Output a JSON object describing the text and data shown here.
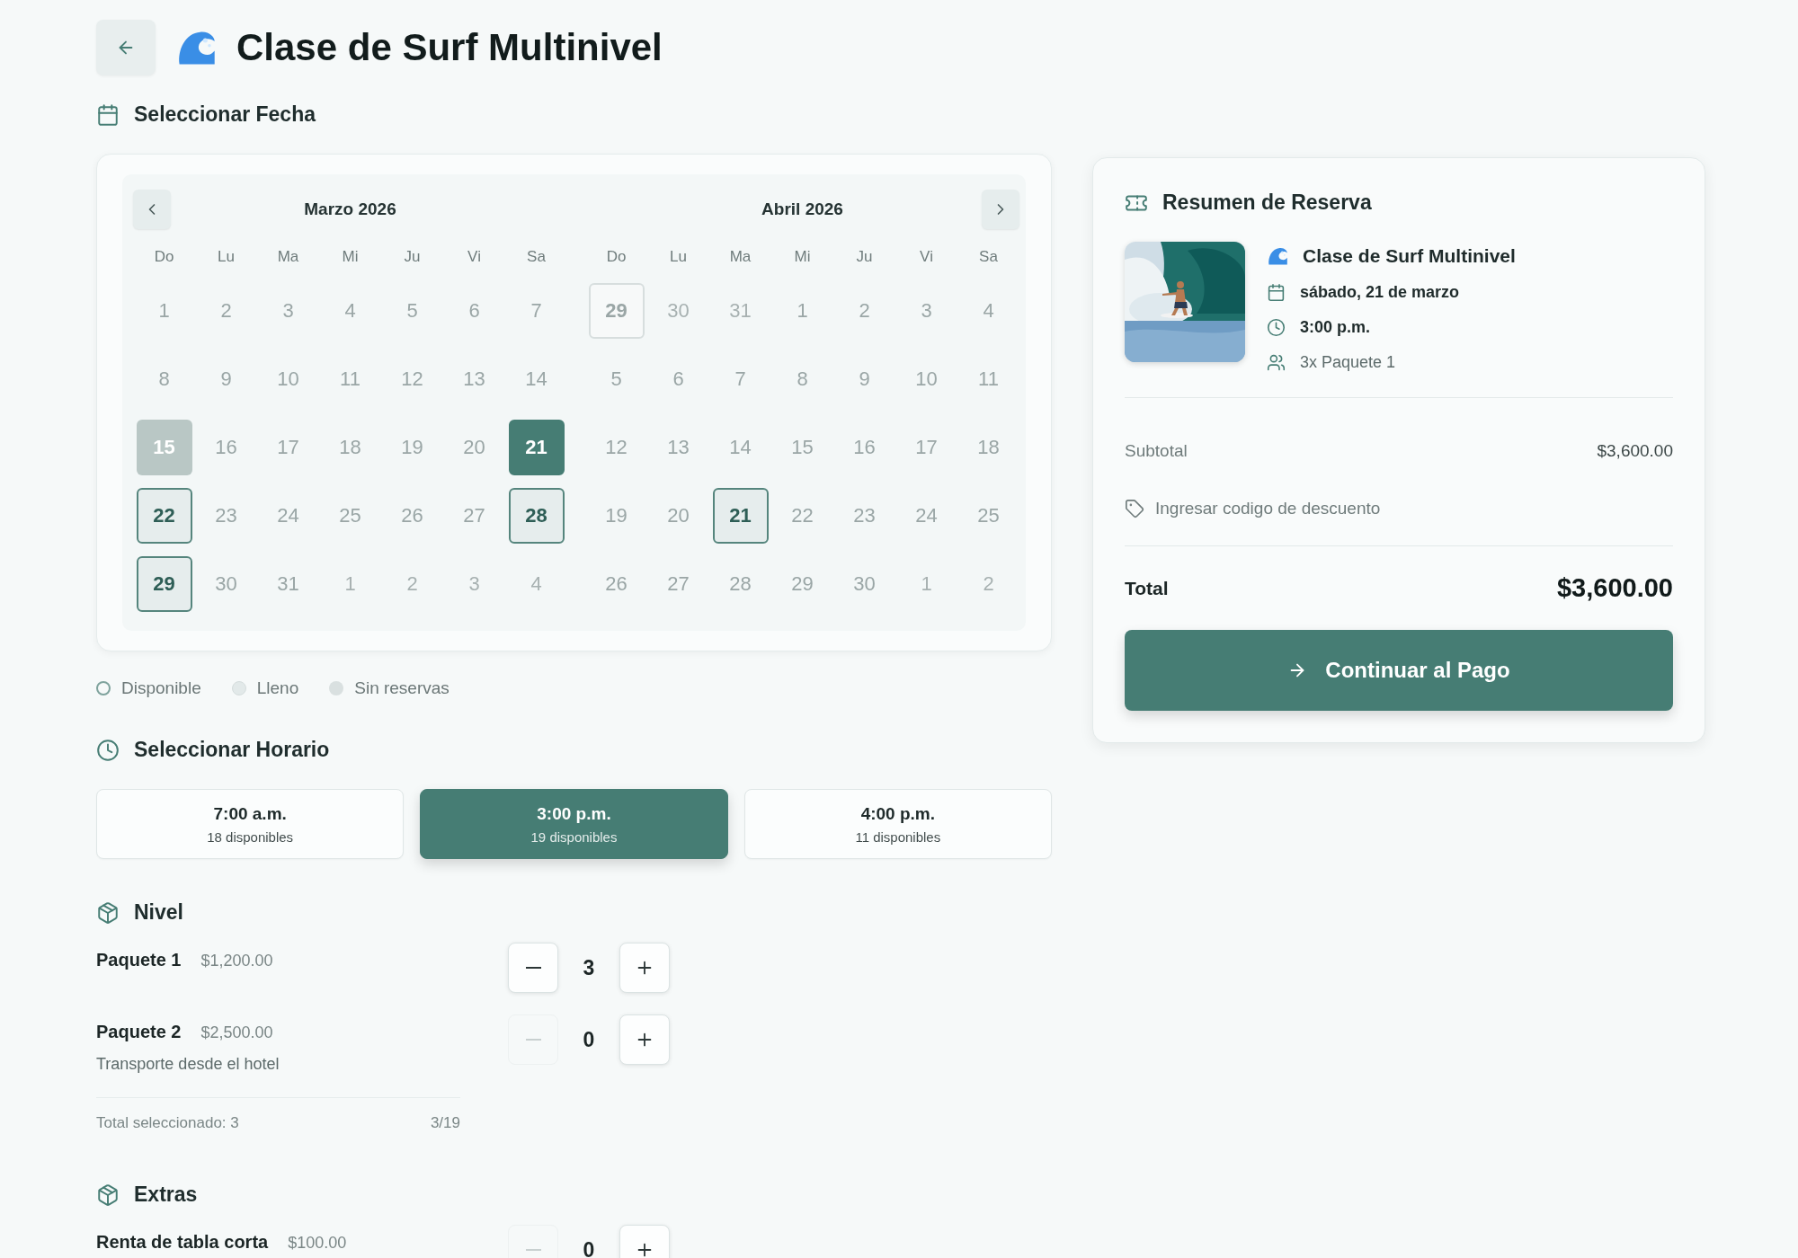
{
  "header": {
    "title": "Clase de Surf Multinivel"
  },
  "date_section": {
    "title": "Seleccionar Fecha",
    "months": [
      {
        "title": "Marzo 2026",
        "prev_button": true,
        "next_button": false,
        "weekdays": [
          "Do",
          "Lu",
          "Ma",
          "Mi",
          "Ju",
          "Vi",
          "Sa"
        ],
        "weeks": [
          [
            {
              "label": "1",
              "kind": "none",
              "selected": false
            },
            {
              "label": "2",
              "kind": "none",
              "selected": false
            },
            {
              "label": "3",
              "kind": "none",
              "selected": false
            },
            {
              "label": "4",
              "kind": "none",
              "selected": false
            },
            {
              "label": "5",
              "kind": "none",
              "selected": false
            },
            {
              "label": "6",
              "kind": "none",
              "selected": false
            },
            {
              "label": "7",
              "kind": "none",
              "selected": false
            }
          ],
          [
            {
              "label": "8",
              "kind": "none",
              "selected": false
            },
            {
              "label": "9",
              "kind": "none",
              "selected": false
            },
            {
              "label": "10",
              "kind": "none",
              "selected": false
            },
            {
              "label": "11",
              "kind": "none",
              "selected": false
            },
            {
              "label": "12",
              "kind": "none",
              "selected": false
            },
            {
              "label": "13",
              "kind": "none",
              "selected": false
            },
            {
              "label": "14",
              "kind": "none",
              "selected": false
            }
          ],
          [
            {
              "label": "15",
              "kind": "full",
              "selected": false
            },
            {
              "label": "16",
              "kind": "none",
              "selected": false
            },
            {
              "label": "17",
              "kind": "none",
              "selected": false
            },
            {
              "label": "18",
              "kind": "none",
              "selected": false
            },
            {
              "label": "19",
              "kind": "none",
              "selected": false
            },
            {
              "label": "20",
              "kind": "none",
              "selected": false
            },
            {
              "label": "21",
              "kind": "available",
              "selected": true
            }
          ],
          [
            {
              "label": "22",
              "kind": "available",
              "selected": false
            },
            {
              "label": "23",
              "kind": "none",
              "selected": false
            },
            {
              "label": "24",
              "kind": "none",
              "selected": false
            },
            {
              "label": "25",
              "kind": "none",
              "selected": false
            },
            {
              "label": "26",
              "kind": "none",
              "selected": false
            },
            {
              "label": "27",
              "kind": "none",
              "selected": false
            },
            {
              "label": "28",
              "kind": "available",
              "selected": false
            }
          ],
          [
            {
              "label": "29",
              "kind": "available",
              "selected": false
            },
            {
              "label": "30",
              "kind": "none",
              "selected": false
            },
            {
              "label": "31",
              "kind": "none",
              "selected": false
            },
            {
              "label": "1",
              "kind": "adjacent",
              "selected": false
            },
            {
              "label": "2",
              "kind": "adjacent",
              "selected": false
            },
            {
              "label": "3",
              "kind": "adjacent",
              "selected": false
            },
            {
              "label": "4",
              "kind": "adjacent",
              "selected": false
            }
          ]
        ]
      },
      {
        "title": "Abril 2026",
        "prev_button": false,
        "next_button": true,
        "weekdays": [
          "Do",
          "Lu",
          "Ma",
          "Mi",
          "Ju",
          "Vi",
          "Sa"
        ],
        "weeks": [
          [
            {
              "label": "29",
              "kind": "adjacent-available",
              "selected": false
            },
            {
              "label": "30",
              "kind": "adjacent",
              "selected": false
            },
            {
              "label": "31",
              "kind": "adjacent",
              "selected": false
            },
            {
              "label": "1",
              "kind": "none",
              "selected": false
            },
            {
              "label": "2",
              "kind": "none",
              "selected": false
            },
            {
              "label": "3",
              "kind": "none",
              "selected": false
            },
            {
              "label": "4",
              "kind": "none",
              "selected": false
            }
          ],
          [
            {
              "label": "5",
              "kind": "none",
              "selected": false
            },
            {
              "label": "6",
              "kind": "none",
              "selected": false
            },
            {
              "label": "7",
              "kind": "none",
              "selected": false
            },
            {
              "label": "8",
              "kind": "none",
              "selected": false
            },
            {
              "label": "9",
              "kind": "none",
              "selected": false
            },
            {
              "label": "10",
              "kind": "none",
              "selected": false
            },
            {
              "label": "11",
              "kind": "none",
              "selected": false
            }
          ],
          [
            {
              "label": "12",
              "kind": "none",
              "selected": false
            },
            {
              "label": "13",
              "kind": "none",
              "selected": false
            },
            {
              "label": "14",
              "kind": "none",
              "selected": false
            },
            {
              "label": "15",
              "kind": "none",
              "selected": false
            },
            {
              "label": "16",
              "kind": "none",
              "selected": false
            },
            {
              "label": "17",
              "kind": "none",
              "selected": false
            },
            {
              "label": "18",
              "kind": "none",
              "selected": false
            }
          ],
          [
            {
              "label": "19",
              "kind": "none",
              "selected": false
            },
            {
              "label": "20",
              "kind": "none",
              "selected": false
            },
            {
              "label": "21",
              "kind": "available",
              "selected": false
            },
            {
              "label": "22",
              "kind": "none",
              "selected": false
            },
            {
              "label": "23",
              "kind": "none",
              "selected": false
            },
            {
              "label": "24",
              "kind": "none",
              "selected": false
            },
            {
              "label": "25",
              "kind": "none",
              "selected": false
            }
          ],
          [
            {
              "label": "26",
              "kind": "none",
              "selected": false
            },
            {
              "label": "27",
              "kind": "none",
              "selected": false
            },
            {
              "label": "28",
              "kind": "none",
              "selected": false
            },
            {
              "label": "29",
              "kind": "none",
              "selected": false
            },
            {
              "label": "30",
              "kind": "none",
              "selected": false
            },
            {
              "label": "1",
              "kind": "adjacent",
              "selected": false
            },
            {
              "label": "2",
              "kind": "adjacent",
              "selected": false
            }
          ]
        ]
      }
    ],
    "legend": [
      {
        "label": "Disponible",
        "kind": "available"
      },
      {
        "label": "Lleno",
        "kind": "full"
      },
      {
        "label": "Sin reservas",
        "kind": "none"
      }
    ]
  },
  "time_section": {
    "title": "Seleccionar Horario",
    "slots": [
      {
        "time": "7:00 a.m.",
        "availability": "18 disponibles",
        "selected": false
      },
      {
        "time": "3:00 p.m.",
        "availability": "19 disponibles",
        "selected": true
      },
      {
        "time": "4:00 p.m.",
        "availability": "11 disponibles",
        "selected": false
      }
    ]
  },
  "level_section": {
    "title": "Nivel",
    "items": [
      {
        "name": "Paquete 1",
        "price": "$1,200.00",
        "quantity": "3",
        "decrease_disabled": false
      },
      {
        "name": "Paquete 2",
        "price": "$2,500.00",
        "description": "Transporte desde el hotel",
        "quantity": "0",
        "decrease_disabled": true
      }
    ],
    "total_label": "Total seleccionado: 3",
    "total_ratio": "3/19"
  },
  "extras_section": {
    "title": "Extras",
    "items": [
      {
        "name": "Renta de tabla corta",
        "price": "$100.00",
        "quantity": "0",
        "decrease_disabled": true
      }
    ]
  },
  "summary": {
    "title": "Resumen de Reserva",
    "event": "Clase de Surf Multinivel",
    "date": "sábado, 21 de marzo",
    "time": "3:00 p.m.",
    "guests": "3x Paquete 1",
    "subtotal_label": "Subtotal",
    "subtotal": "$3,600.00",
    "discount_link": "Ingresar codigo de descuento",
    "total_label": "Total",
    "total": "$3,600.00",
    "cta": "Continuar al Pago"
  }
}
